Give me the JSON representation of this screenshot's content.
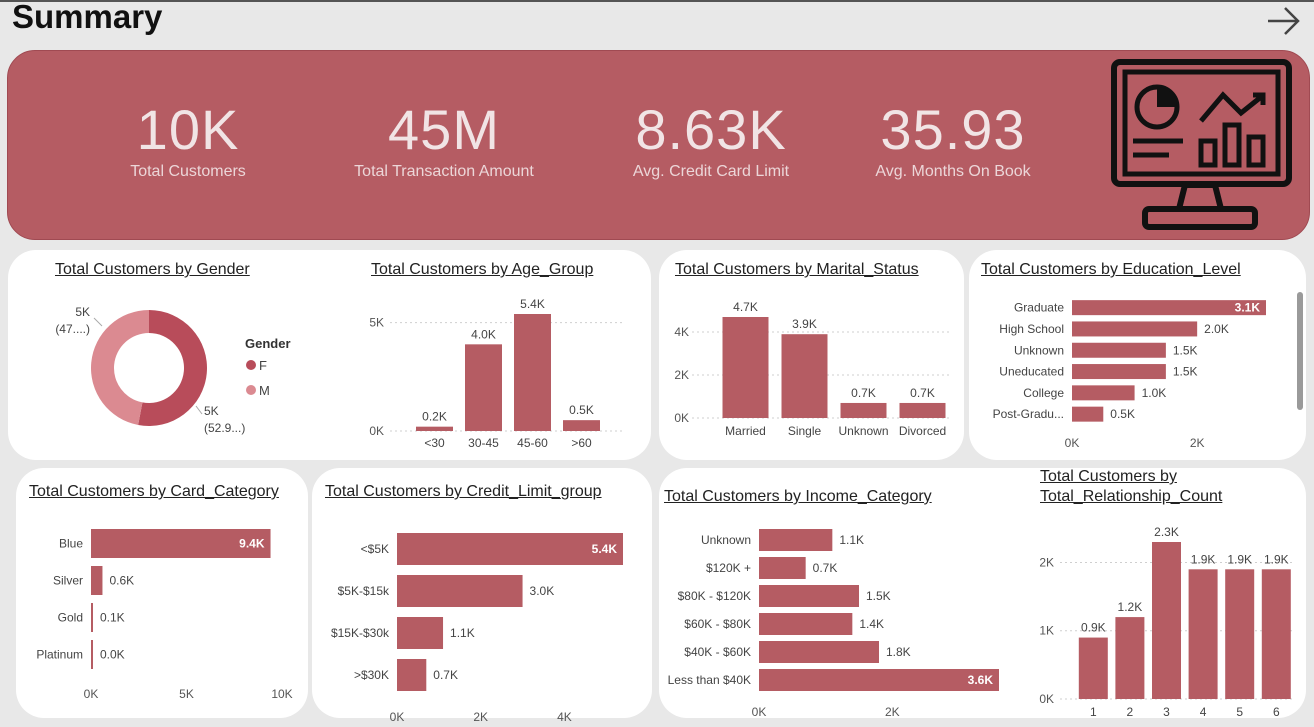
{
  "header": {
    "title": "Summary",
    "next_icon": "arrow-right-icon"
  },
  "kpis": [
    {
      "value": "10K",
      "label": "Total Customers"
    },
    {
      "value": "45M",
      "label": "Total Transaction Amount"
    },
    {
      "value": "8.63K",
      "label": "Avg. Credit Card Limit"
    },
    {
      "value": "35.93",
      "label": "Avg. Months On Book"
    }
  ],
  "banner_icon": "dashboard-monitor-icon",
  "colors": {
    "accent": "#b55c63",
    "bar": "#b55c63",
    "female": "#b84c5a",
    "male": "#db8a91"
  },
  "chart_data": [
    {
      "id": "gender",
      "type": "pie",
      "title": "Total Customers by Gender",
      "legend_title": "Gender",
      "categories": [
        "F",
        "M"
      ],
      "values": [
        5300,
        4700
      ],
      "labels": [
        [
          "5K",
          "(52.9...)"
        ],
        [
          "5K",
          "(47....)"
        ]
      ]
    },
    {
      "id": "age",
      "type": "bar",
      "title": "Total Customers by Age_Group",
      "categories": [
        "<30",
        "30-45",
        "45-60",
        ">60"
      ],
      "values": [
        200,
        4000,
        5400,
        500
      ],
      "data_labels": [
        "0.2K",
        "4.0K",
        "5.4K",
        "0.5K"
      ],
      "ticks": [
        {
          "v": 0,
          "t": "0K"
        },
        {
          "v": 5000,
          "t": "5K"
        }
      ],
      "ylim": [
        0,
        5400
      ]
    },
    {
      "id": "marital",
      "type": "bar",
      "title": "Total Customers by Marital_Status",
      "categories": [
        "Married",
        "Single",
        "Unknown",
        "Divorced"
      ],
      "values": [
        4700,
        3900,
        700,
        700
      ],
      "data_labels": [
        "4.7K",
        "3.9K",
        "0.7K",
        "0.7K"
      ],
      "ticks": [
        {
          "v": 0,
          "t": "0K"
        },
        {
          "v": 2000,
          "t": "2K"
        },
        {
          "v": 4000,
          "t": "4K"
        }
      ],
      "ylim": [
        0,
        4700
      ]
    },
    {
      "id": "education",
      "type": "bar",
      "orientation": "horizontal",
      "title": "Total Customers by Education_Level",
      "categories": [
        "Graduate",
        "High School",
        "Unknown",
        "Uneducated",
        "College",
        "Post-Gradu..."
      ],
      "values": [
        3100,
        2000,
        1500,
        1500,
        1000,
        500
      ],
      "data_labels": [
        "3.1K",
        "2.0K",
        "1.5K",
        "1.5K",
        "1.0K",
        "0.5K"
      ],
      "ticks": [
        {
          "v": 0,
          "t": "0K"
        },
        {
          "v": 2000,
          "t": "2K"
        }
      ],
      "xlim": [
        0,
        3100
      ]
    },
    {
      "id": "card",
      "type": "bar",
      "orientation": "horizontal",
      "title": "Total Customers by Card_Category",
      "categories": [
        "Blue",
        "Silver",
        "Gold",
        "Platinum"
      ],
      "values": [
        9400,
        600,
        100,
        20
      ],
      "data_labels": [
        "9.4K",
        "0.6K",
        "0.1K",
        "0.0K"
      ],
      "ticks": [
        {
          "v": 0,
          "t": "0K"
        },
        {
          "v": 5000,
          "t": "5K"
        },
        {
          "v": 10000,
          "t": "10K"
        }
      ],
      "xlim": [
        0,
        10000
      ]
    },
    {
      "id": "credit",
      "type": "bar",
      "orientation": "horizontal",
      "title": "Total Customers by Credit_Limit_group",
      "categories": [
        "<$5K",
        "$5K-$15k",
        "$15K-$30k",
        ">$30K"
      ],
      "values": [
        5400,
        3000,
        1100,
        700
      ],
      "data_labels": [
        "5.4K",
        "3.0K",
        "1.1K",
        "0.7K"
      ],
      "ticks": [
        {
          "v": 0,
          "t": "0K"
        },
        {
          "v": 2000,
          "t": "2K"
        },
        {
          "v": 4000,
          "t": "4K"
        }
      ],
      "xlim": [
        0,
        5400
      ]
    },
    {
      "id": "income",
      "type": "bar",
      "orientation": "horizontal",
      "title": "Total Customers by Income_Category",
      "categories": [
        "Unknown",
        "$120K +",
        "$80K - $120K",
        "$60K - $80K",
        "$40K - $60K",
        "Less than $40K"
      ],
      "values": [
        1100,
        700,
        1500,
        1400,
        1800,
        3600
      ],
      "data_labels": [
        "1.1K",
        "0.7K",
        "1.5K",
        "1.4K",
        "1.8K",
        "3.6K"
      ],
      "ticks": [
        {
          "v": 0,
          "t": "0K"
        },
        {
          "v": 2000,
          "t": "2K"
        }
      ],
      "xlim": [
        0,
        3600
      ]
    },
    {
      "id": "relationship",
      "type": "bar",
      "title": "Total Customers by Total_Relationship_Count",
      "title_lines": [
        "Total Customers by",
        "Total_Relationship_Count"
      ],
      "categories": [
        "1",
        "2",
        "3",
        "4",
        "5",
        "6"
      ],
      "values": [
        900,
        1200,
        2300,
        1900,
        1900,
        1900
      ],
      "data_labels": [
        "0.9K",
        "1.2K",
        "2.3K",
        "1.9K",
        "1.9K",
        "1.9K"
      ],
      "ticks": [
        {
          "v": 0,
          "t": "0K"
        },
        {
          "v": 1000,
          "t": "1K"
        },
        {
          "v": 2000,
          "t": "2K"
        }
      ],
      "ylim": [
        0,
        2300
      ]
    }
  ]
}
